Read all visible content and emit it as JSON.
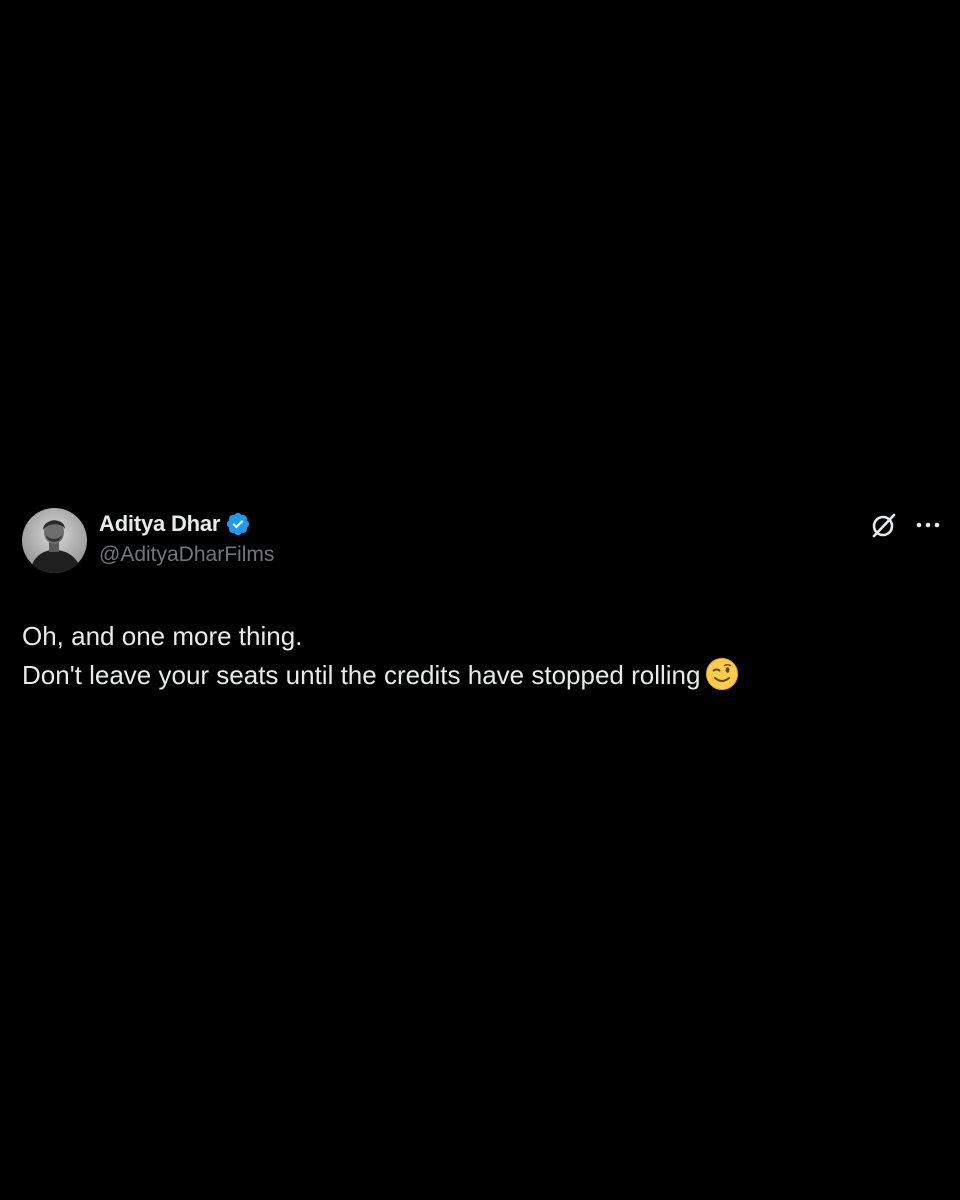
{
  "author": {
    "display_name": "Aditya Dhar",
    "handle": "@AdityaDharFilms",
    "verified": true,
    "verified_color": "#1d9bf0"
  },
  "icons": {
    "verified": "verified-badge-icon",
    "grok": "grok-icon",
    "more": "more-options-icon",
    "emoji": "winking-face-emoji"
  },
  "tweet": {
    "line1": "Oh, and one more thing.",
    "line2": "Don't leave your seats until the credits have stopped rolling"
  },
  "colors": {
    "background": "#000000",
    "text_primary": "#e7e9ea",
    "text_secondary": "#71767b"
  }
}
